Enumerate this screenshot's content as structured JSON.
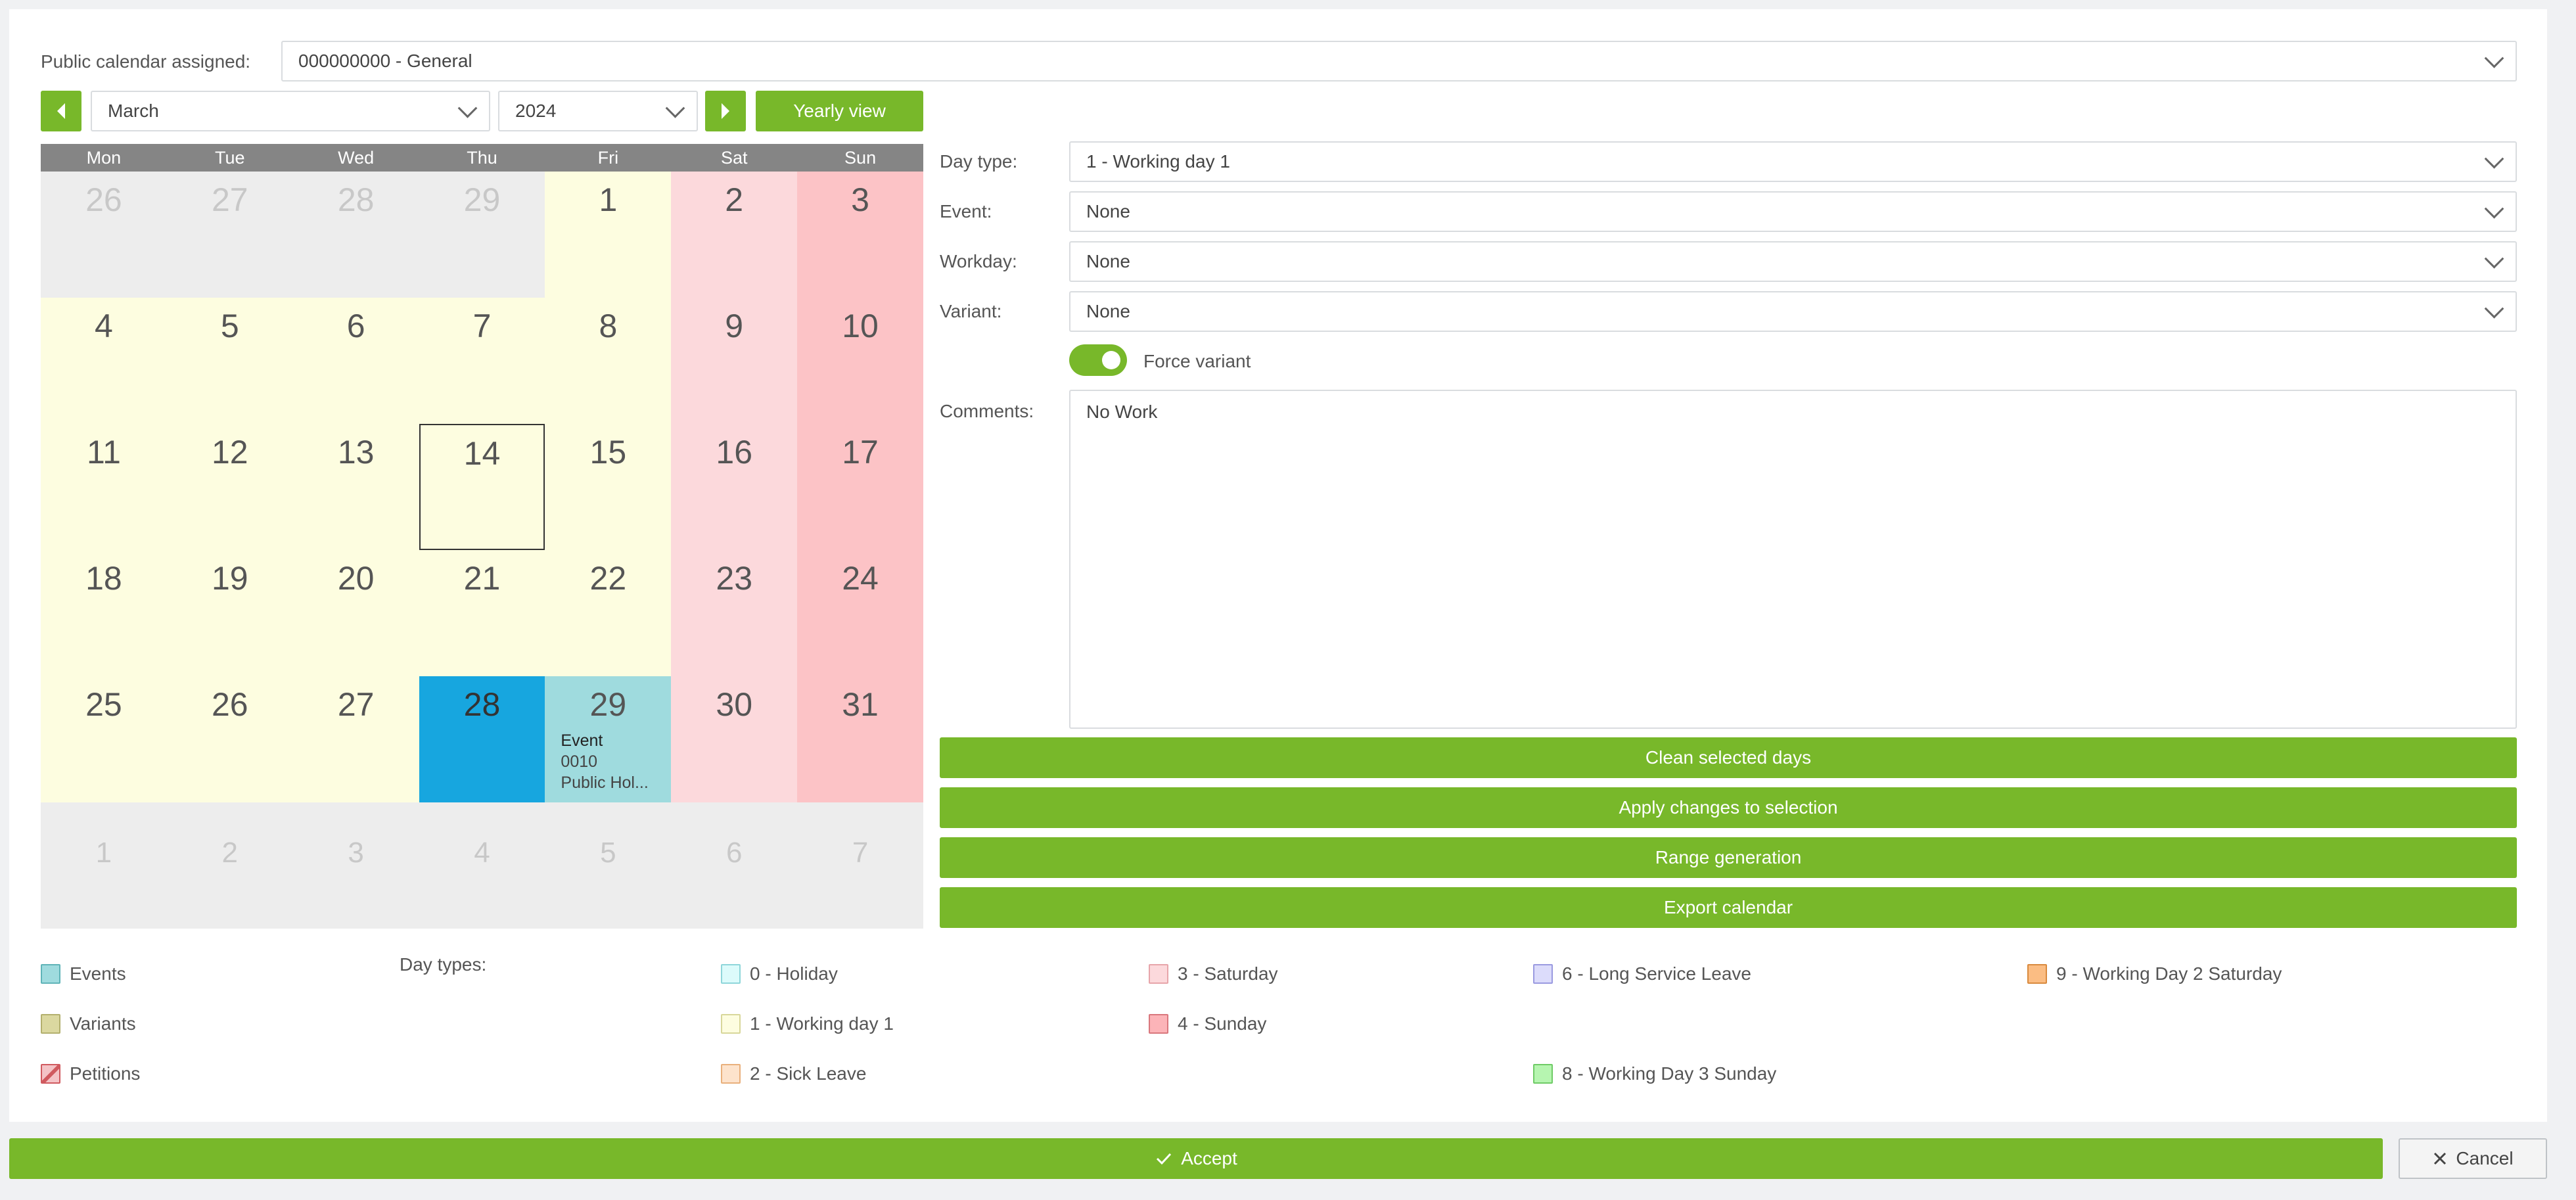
{
  "public_calendar": {
    "label": "Public calendar assigned:",
    "value": "000000000 - General"
  },
  "nav": {
    "month": "March",
    "year": "2024",
    "yearly_view": "Yearly view"
  },
  "weekdays": [
    "Mon",
    "Tue",
    "Wed",
    "Thu",
    "Fri",
    "Sat",
    "Sun"
  ],
  "calendar": {
    "rows": [
      [
        {
          "day": "26",
          "type": "other"
        },
        {
          "day": "27",
          "type": "other"
        },
        {
          "day": "28",
          "type": "other"
        },
        {
          "day": "29",
          "type": "other"
        },
        {
          "day": "1",
          "type": "work"
        },
        {
          "day": "2",
          "type": "sat"
        },
        {
          "day": "3",
          "type": "sun"
        }
      ],
      [
        {
          "day": "4",
          "type": "work"
        },
        {
          "day": "5",
          "type": "work"
        },
        {
          "day": "6",
          "type": "work"
        },
        {
          "day": "7",
          "type": "work"
        },
        {
          "day": "8",
          "type": "work"
        },
        {
          "day": "9",
          "type": "sat"
        },
        {
          "day": "10",
          "type": "sun"
        }
      ],
      [
        {
          "day": "11",
          "type": "work"
        },
        {
          "day": "12",
          "type": "work"
        },
        {
          "day": "13",
          "type": "work"
        },
        {
          "day": "14",
          "type": "sel"
        },
        {
          "day": "15",
          "type": "work"
        },
        {
          "day": "16",
          "type": "sat"
        },
        {
          "day": "17",
          "type": "sun"
        }
      ],
      [
        {
          "day": "18",
          "type": "work"
        },
        {
          "day": "19",
          "type": "work"
        },
        {
          "day": "20",
          "type": "work"
        },
        {
          "day": "21",
          "type": "work"
        },
        {
          "day": "22",
          "type": "work"
        },
        {
          "day": "23",
          "type": "sat"
        },
        {
          "day": "24",
          "type": "sun"
        }
      ],
      [
        {
          "day": "25",
          "type": "work"
        },
        {
          "day": "26",
          "type": "work"
        },
        {
          "day": "27",
          "type": "work"
        },
        {
          "day": "28",
          "type": "today"
        },
        {
          "day": "29",
          "type": "event",
          "event": [
            "Event",
            "0010",
            "Public Hol..."
          ]
        },
        {
          "day": "30",
          "type": "sat"
        },
        {
          "day": "31",
          "type": "sun"
        }
      ],
      [
        {
          "day": "1",
          "type": "next"
        },
        {
          "day": "2",
          "type": "next"
        },
        {
          "day": "3",
          "type": "next"
        },
        {
          "day": "4",
          "type": "next"
        },
        {
          "day": "5",
          "type": "next"
        },
        {
          "day": "6",
          "type": "next"
        },
        {
          "day": "7",
          "type": "next"
        }
      ]
    ]
  },
  "form": {
    "day_type_label": "Day type:",
    "day_type_value": "1 - Working day 1",
    "event_label": "Event:",
    "event_value": "None",
    "workday_label": "Workday:",
    "workday_value": "None",
    "variant_label": "Variant:",
    "variant_value": "None",
    "force_variant_label": "Force variant",
    "comments_label": "Comments:",
    "comments_value": "No Work"
  },
  "actions": {
    "clean": "Clean selected days",
    "apply": "Apply changes to selection",
    "range": "Range generation",
    "export": "Export calendar"
  },
  "legend": {
    "day_types_label": "Day types:",
    "left": [
      {
        "label": "Events",
        "fill": "#9fdbde",
        "stroke": "#5fb4b8"
      },
      {
        "label": "Variants",
        "fill": "#dbd8a0",
        "stroke": "#b3b06e"
      },
      {
        "label": "Petitions",
        "fill": "#f4c3c6",
        "stroke": "#d05a5f"
      }
    ],
    "types": [
      {
        "label": "0 - Holiday",
        "fill": "#dcfbfb",
        "stroke": "#8ed6da"
      },
      {
        "label": "1 - Working day 1",
        "fill": "#fdfde0",
        "stroke": "#d8d79a"
      },
      {
        "label": "2 - Sick Leave",
        "fill": "#fde3cc",
        "stroke": "#e9b07c"
      },
      {
        "label": "3 - Saturday",
        "fill": "#fcd9dc",
        "stroke": "#e7a5aa"
      },
      {
        "label": "4 - Sunday",
        "fill": "#fcb4b8",
        "stroke": "#d9777d"
      },
      {
        "label": "6 - Long Service Leave",
        "fill": "#dcdcfb",
        "stroke": "#9a9ae0"
      },
      {
        "label": "8 - Working Day 3 Sunday",
        "fill": "#b6f5b0",
        "stroke": "#6fcb66"
      },
      {
        "label": "9 - Working Day 2 Saturday",
        "fill": "#fbbd83",
        "stroke": "#d98a3e"
      }
    ]
  },
  "footer": {
    "accept": "Accept",
    "cancel": "Cancel"
  },
  "colors": {
    "accent_green": "#78b82a",
    "today_blue": "#17a6df",
    "event_teal": "#9fdbde"
  }
}
